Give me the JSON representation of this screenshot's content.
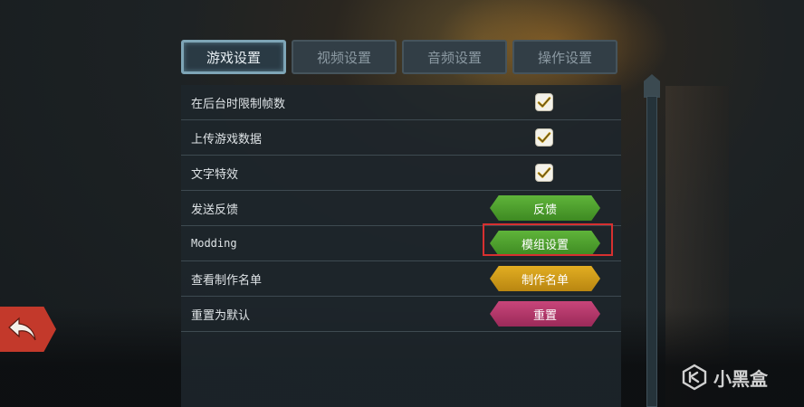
{
  "tabs": [
    {
      "label": "游戏设置",
      "active": true
    },
    {
      "label": "视频设置",
      "active": false
    },
    {
      "label": "音频设置",
      "active": false
    },
    {
      "label": "操作设置",
      "active": false
    }
  ],
  "settings": [
    {
      "label": "在后台时限制帧数",
      "control": "checkbox",
      "checked": true
    },
    {
      "label": "上传游戏数据",
      "control": "checkbox",
      "checked": true
    },
    {
      "label": "文字特效",
      "control": "checkbox",
      "checked": true
    },
    {
      "label": "发送反馈",
      "control": "button",
      "button_label": "反馈",
      "button_color": "#4f9f2e"
    },
    {
      "label": "Modding",
      "control": "button",
      "button_label": "模组设置",
      "button_color": "#4f9f2e"
    },
    {
      "label": "查看制作名单",
      "control": "button",
      "button_label": "制作名单",
      "button_color": "#d09a1a"
    },
    {
      "label": "重置为默认",
      "control": "button",
      "button_label": "重置",
      "button_color": "#b33a6c"
    }
  ],
  "back_button": {
    "icon": "return-arrow-icon",
    "color": "#c3392b"
  },
  "watermark": {
    "text": "小黑盒",
    "icon": "xiaoheihe-logo-icon"
  },
  "colors": {
    "highlight": "#d63030",
    "check": "#c89a10"
  }
}
